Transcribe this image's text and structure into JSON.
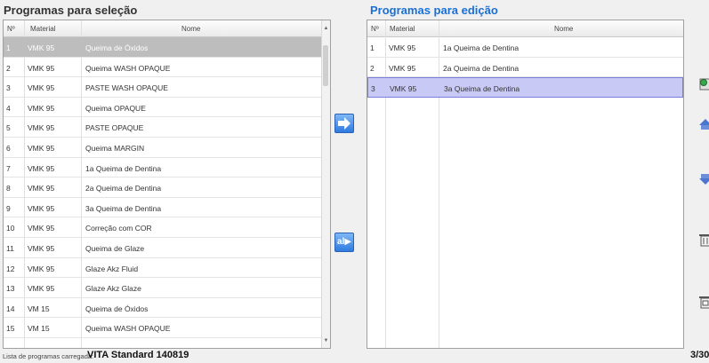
{
  "left": {
    "title": "Programas para seleção",
    "columns": {
      "num": "Nº",
      "material": "Material",
      "name": "Nome"
    },
    "rows": [
      {
        "num": "1",
        "material": "VMK 95",
        "name": "Queima de Óxidos"
      },
      {
        "num": "2",
        "material": "VMK 95",
        "name": "Queima WASH OPAQUE"
      },
      {
        "num": "3",
        "material": "VMK 95",
        "name": "PASTE WASH OPAQUE"
      },
      {
        "num": "4",
        "material": "VMK 95",
        "name": "Queima OPAQUE"
      },
      {
        "num": "5",
        "material": "VMK 95",
        "name": "PASTE OPAQUE"
      },
      {
        "num": "6",
        "material": "VMK 95",
        "name": "Queima MARGIN"
      },
      {
        "num": "7",
        "material": "VMK 95",
        "name": "1a Queima de Dentina"
      },
      {
        "num": "8",
        "material": "VMK 95",
        "name": "2a Queima de Dentina"
      },
      {
        "num": "9",
        "material": "VMK 95",
        "name": "3a Queima de Dentina"
      },
      {
        "num": "10",
        "material": "VMK 95",
        "name": "Correção com COR"
      },
      {
        "num": "11",
        "material": "VMK 95",
        "name": "Queima de Glaze"
      },
      {
        "num": "12",
        "material": "VMK 95",
        "name": "Glaze Akz Fluid"
      },
      {
        "num": "13",
        "material": "VMK 95",
        "name": "Glaze Akz Glaze"
      },
      {
        "num": "14",
        "material": "VM 15",
        "name": "Queima de Óxidos"
      },
      {
        "num": "15",
        "material": "VM 15",
        "name": "Queima WASH OPAQUE"
      }
    ]
  },
  "right": {
    "title": "Programas para edição",
    "columns": {
      "num": "Nº",
      "material": "Material",
      "name": "Nome"
    },
    "rows": [
      {
        "num": "1",
        "material": "VMK 95",
        "name": "1a Queima de Dentina"
      },
      {
        "num": "2",
        "material": "VMK 95",
        "name": "2a Queima de Dentina"
      },
      {
        "num": "3",
        "material": "VMK 95",
        "name": "3a Queima de Dentina"
      }
    ]
  },
  "buttons": {
    "add_all_label": "al"
  },
  "status": {
    "label": "Lista de programas carregada:",
    "value": "VITA Standard 140819",
    "count": "3/30"
  },
  "colors": {
    "accent": "#1a6fd6",
    "selection_gray": "#bdbdbd",
    "selection_blue": "#c9c9f5"
  }
}
